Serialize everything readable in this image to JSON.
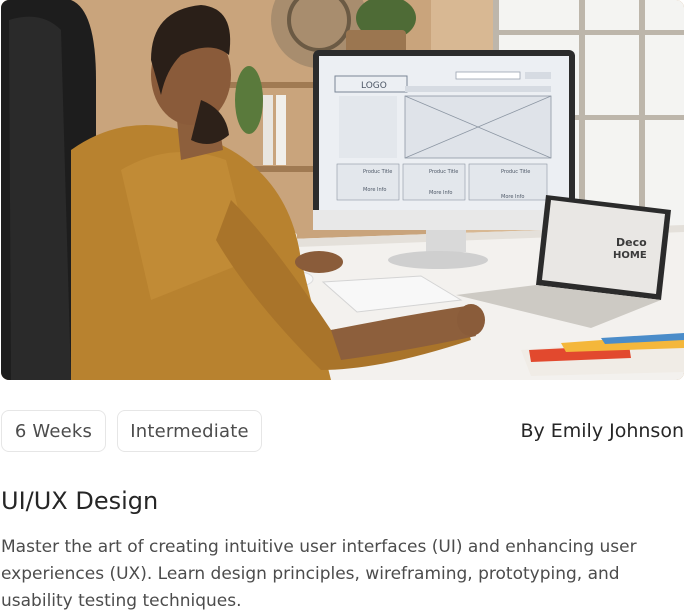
{
  "course": {
    "image_alt": "Designer working on a website wireframe at a desktop computer",
    "screen": {
      "logo": "LOGO",
      "product_title": "Produc Title",
      "more_info": "More Info",
      "laptop_line1": "Deco",
      "laptop_line2": "HOME"
    },
    "duration": "6 Weeks",
    "level": "Intermediate",
    "author": "By Emily Johnson",
    "title": "UI/UX Design",
    "description": "Master the art of creating intuitive user interfaces (UI) and enhancing user experiences (UX). Learn design principles, wireframing, prototyping, and usability testing techniques."
  },
  "colors": {
    "text_primary": "#262626",
    "text_secondary": "#4c4c4c",
    "border": "#e6e6e6"
  }
}
